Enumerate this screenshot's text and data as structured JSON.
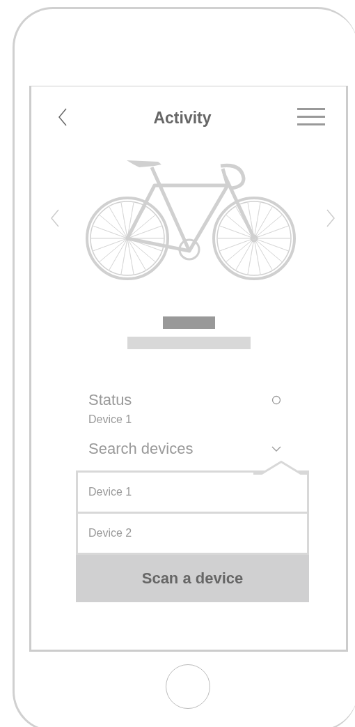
{
  "header": {
    "title": "Activity"
  },
  "status": {
    "label": "Status",
    "device": "Device 1"
  },
  "device_search": {
    "label": "Search devices",
    "expanded": true,
    "options": [
      {
        "label": "Device 1"
      },
      {
        "label": "Device 2"
      }
    ],
    "scan_button": "Scan a device"
  }
}
